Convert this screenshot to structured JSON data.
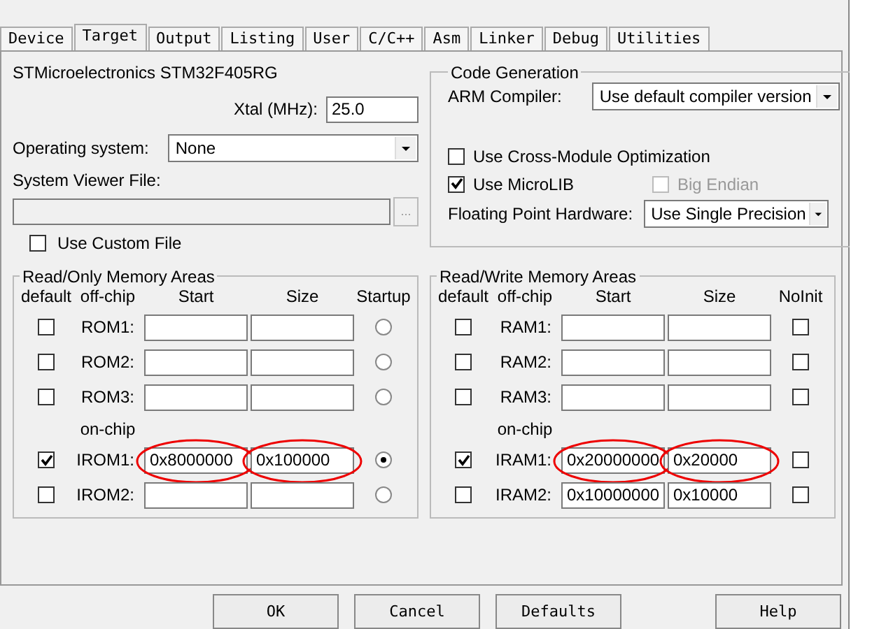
{
  "tabs": [
    {
      "label": "Device",
      "selected": false
    },
    {
      "label": "Target",
      "selected": true
    },
    {
      "label": "Output",
      "selected": false
    },
    {
      "label": "Listing",
      "selected": false
    },
    {
      "label": "User",
      "selected": false
    },
    {
      "label": "C/C++",
      "selected": false
    },
    {
      "label": "Asm",
      "selected": false
    },
    {
      "label": "Linker",
      "selected": false
    },
    {
      "label": "Debug",
      "selected": false
    },
    {
      "label": "Utilities",
      "selected": false
    }
  ],
  "device": "STMicroelectronics STM32F405RG",
  "xtal": {
    "label": "Xtal (MHz):",
    "value": "25.0"
  },
  "operating_system": {
    "label": "Operating system:",
    "value": "None"
  },
  "system_viewer": {
    "label": "System Viewer File:",
    "browse": "...",
    "custom": {
      "label": "Use Custom File",
      "checked": false
    }
  },
  "code_generation": {
    "title": "Code Generation",
    "compiler_label": "ARM Compiler:",
    "compiler": "Use default compiler version",
    "options": [
      {
        "label": "Use Cross-Module Optimization",
        "checked": false,
        "disabled": false
      },
      {
        "label": "Use MicroLIB",
        "checked": true,
        "disabled": false
      },
      {
        "label": "Big Endian",
        "checked": false,
        "disabled": true
      }
    ],
    "fpu_label": "Floating Point Hardware:",
    "fpu": "Use Single Precision"
  },
  "rom": {
    "title": "Read/Only Memory Areas",
    "columns": [
      "default",
      "off-chip",
      "Start",
      "Size",
      "Startup"
    ],
    "onchip_label": "on-chip",
    "rows": [
      {
        "label": "ROM1:",
        "default": false,
        "start": "",
        "size": "",
        "flag": false,
        "circled": false
      },
      {
        "label": "ROM2:",
        "default": false,
        "start": "",
        "size": "",
        "flag": false,
        "circled": false
      },
      {
        "label": "ROM3:",
        "default": false,
        "start": "",
        "size": "",
        "flag": false,
        "circled": false
      },
      {
        "label": "IROM1:",
        "default": true,
        "start": "0x8000000",
        "size": "0x100000",
        "flag": true,
        "circled": true
      },
      {
        "label": "IROM2:",
        "default": false,
        "start": "",
        "size": "",
        "flag": false,
        "circled": false
      }
    ]
  },
  "ram": {
    "title": "Read/Write Memory Areas",
    "columns": [
      "default",
      "off-chip",
      "Start",
      "Size",
      "NoInit"
    ],
    "onchip_label": "on-chip",
    "rows": [
      {
        "label": "RAM1:",
        "default": false,
        "start": "",
        "size": "",
        "flag": false,
        "circled": false
      },
      {
        "label": "RAM2:",
        "default": false,
        "start": "",
        "size": "",
        "flag": false,
        "circled": false
      },
      {
        "label": "RAM3:",
        "default": false,
        "start": "",
        "size": "",
        "flag": false,
        "circled": false
      },
      {
        "label": "IRAM1:",
        "default": true,
        "start": "0x20000000",
        "size": "0x20000",
        "flag": false,
        "circled": true
      },
      {
        "label": "IRAM2:",
        "default": false,
        "start": "0x10000000",
        "size": "0x10000",
        "flag": false,
        "circled": false
      }
    ]
  },
  "buttons": [
    "OK",
    "Cancel",
    "Defaults",
    "Help"
  ]
}
